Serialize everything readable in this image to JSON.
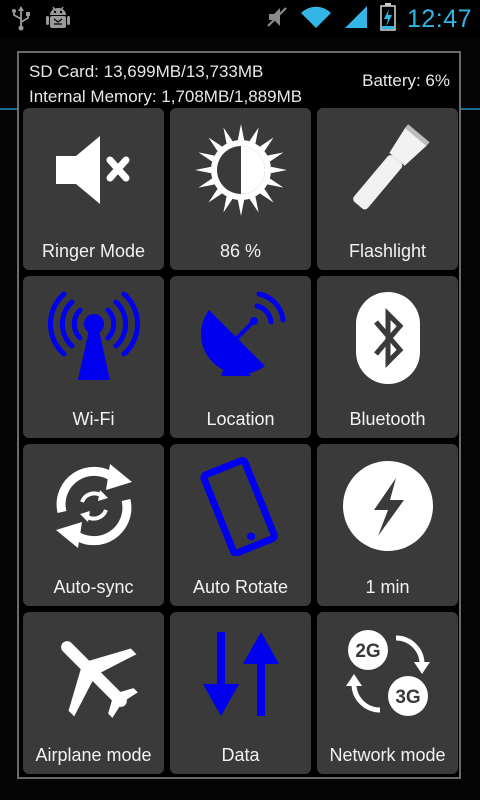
{
  "status_bar": {
    "clock": "12:47",
    "left_icons": [
      "usb-icon",
      "android-debug-icon"
    ],
    "right_icons": [
      "ringer-muted-icon",
      "wifi-signal-icon",
      "cellular-signal-icon",
      "battery-charging-icon"
    ],
    "accent_color": "#33b5e5"
  },
  "panel": {
    "sd_card": "SD Card: 13,699MB/13,733MB",
    "internal_memory": "Internal Memory: 1,708MB/1,889MB",
    "battery": "Battery: 6%"
  },
  "tiles": [
    {
      "label": "Ringer Mode",
      "icon": "speaker-muted-icon",
      "active": false
    },
    {
      "label": "86 %",
      "icon": "brightness-icon",
      "active": false
    },
    {
      "label": "Flashlight",
      "icon": "flashlight-icon",
      "active": false
    },
    {
      "label": "Wi-Fi",
      "icon": "wifi-tower-icon",
      "active": true
    },
    {
      "label": "Location",
      "icon": "satellite-dish-icon",
      "active": true
    },
    {
      "label": "Bluetooth",
      "icon": "bluetooth-icon",
      "active": false
    },
    {
      "label": "Auto-sync",
      "icon": "sync-icon",
      "active": false
    },
    {
      "label": "Auto Rotate",
      "icon": "rotate-phone-icon",
      "active": true
    },
    {
      "label": "1 min",
      "icon": "screen-timeout-icon",
      "active": false
    },
    {
      "label": "Airplane mode",
      "icon": "airplane-icon",
      "active": false
    },
    {
      "label": "Data",
      "icon": "data-arrows-icon",
      "active": true
    },
    {
      "label": "Network mode",
      "icon": "network-mode-icon",
      "active": false
    }
  ],
  "network_mode_badges": [
    "2G",
    "3G"
  ],
  "colors": {
    "active_icon": "#0000ee",
    "inactive_icon": "#ffffff",
    "tile_background": "#3a3a3a"
  }
}
